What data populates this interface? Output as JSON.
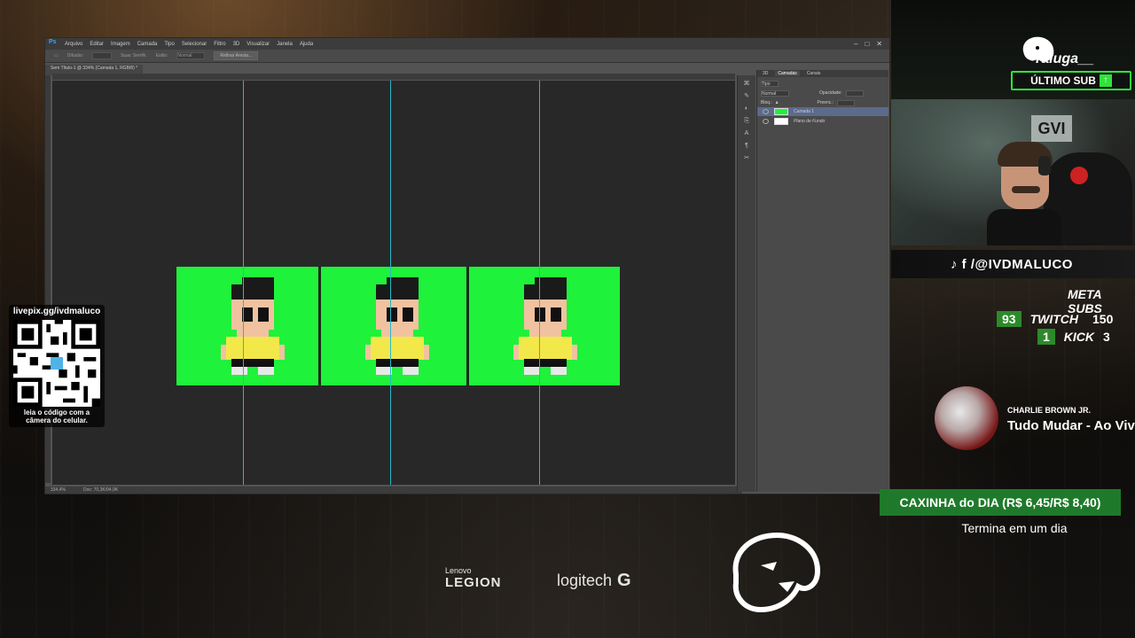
{
  "photoshop": {
    "app_badge": "Ps",
    "menu": [
      "Arquivo",
      "Editar",
      "Imagem",
      "Camada",
      "Tipo",
      "Selecionar",
      "Filtro",
      "3D",
      "Visualizar",
      "Janela",
      "Ajuda"
    ],
    "window_controls": [
      "–",
      "□",
      "✕"
    ],
    "options": {
      "difusao_label": "Difusão:",
      "suav_label": "Suav. Serrilh.",
      "estilo_label": "Estilo:",
      "estilo_value": "Normal",
      "refine_button": "Refinar Aresta..."
    },
    "document_tab": "Sem Título-1 @ 334% (Camada 1, RGB/8) *",
    "status": {
      "zoom": "334,4%",
      "doc": "Doc: 70,3K/94,9K"
    },
    "layers_panel": {
      "tabs": [
        "3D",
        "Camadas",
        "Canais"
      ],
      "active_tab": "Camadas",
      "filter_label": "Tipo",
      "blend_mode": "Normal",
      "opacity_label": "Opacidade:",
      "lock_label": "Bloq.:",
      "fill_label": "Preenc.:",
      "layers": [
        {
          "name": "Camada 1",
          "selected": true
        },
        {
          "name": "Plano de Fundo",
          "selected": false
        }
      ]
    }
  },
  "overlay": {
    "qr_title": "livepix.gg/ivdmaluco",
    "qr_caption_line1": "leia o código com a",
    "qr_caption_line2": "câmera do celular.",
    "last_sub_user": "raiuga__",
    "last_sub_label": "ÚLTIMO SUB",
    "social_handle": "♪ f /@IVDMALUCO",
    "meta_title": "META SUBS",
    "twitch": {
      "current": "93",
      "label": "TWITCH",
      "goal": "150"
    },
    "kick": {
      "current": "1",
      "label": "KICK",
      "goal": "3"
    },
    "music": {
      "artist": "CHARLIE BROWN JR.",
      "title": "Tudo Mudar - Ao Vivo"
    },
    "caixinha": "CAXINHA do DIA (R$ 6,45/R$ 8,40)",
    "caixinha_sub": "Termina em um dia",
    "sponsors": {
      "lenovo_small": "Lenovo",
      "lenovo_big": "LEGION",
      "logitech": "logitech",
      "logitech_g": "G"
    }
  },
  "colors": {
    "guide": "#27b7c8",
    "sprite_bg": "#1ff23a",
    "accent_green": "#2fe33a"
  }
}
